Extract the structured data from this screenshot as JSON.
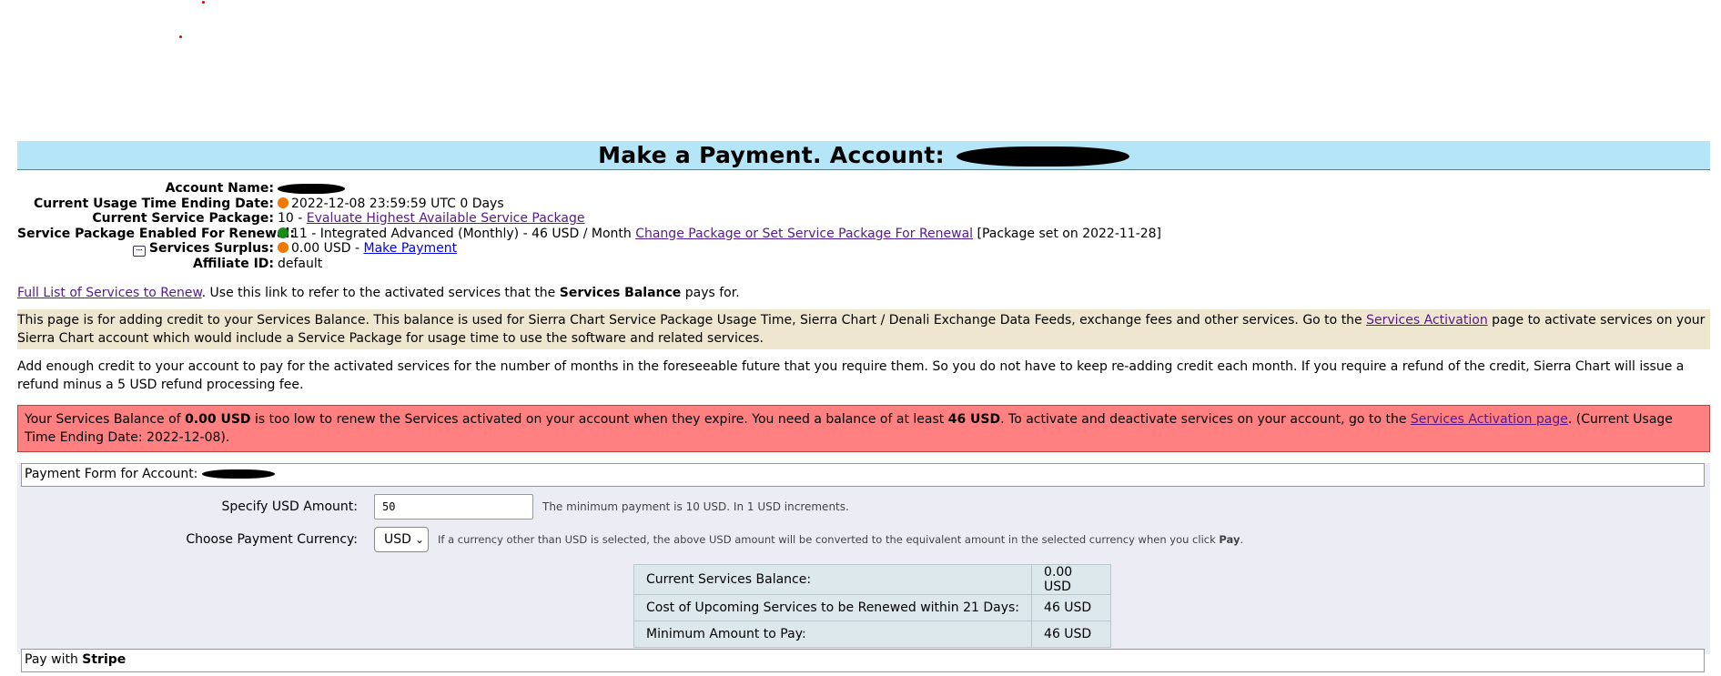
{
  "header": {
    "title": "Make a Payment. Account:"
  },
  "account": {
    "account_name_label": "Account Name:",
    "usage_label": "Current Usage Time Ending Date:",
    "usage_value": "2022-12-08 23:59:59 UTC 0 Days",
    "package_label": "Current Service Package:",
    "package_value": "10 -",
    "package_link": "Evaluate Highest Available Service Package",
    "renewal_label": "Service Package Enabled For Renewal:",
    "renewal_value": "11 - Integrated Advanced (Monthly) - 46 USD / Month",
    "renewal_link": "Change Package or Set Service Package For Renewal",
    "renewal_note": "[Package set on 2022-11-28]",
    "surplus_label": "Services Surplus:",
    "surplus_value": "0.00 USD -",
    "surplus_link": "Make Payment",
    "affiliate_label": "Affiliate ID:",
    "affiliate_value": "default"
  },
  "renew": {
    "link": "Full List of Services to Renew",
    "text1": ". Use this link to refer to the activated services that the ",
    "bold": "Services Balance",
    "text2": " pays for."
  },
  "info_para": {
    "text1": "This page is for adding credit to your Services Balance. This balance is used for Sierra Chart Service Package Usage Time, Sierra Chart / Denali Exchange Data Feeds, exchange fees and other services. Go to the ",
    "link": "Services Activation",
    "text2": " page to activate services on your Sierra Chart account which would include a Service Package for usage time to use the software and related services."
  },
  "add_para": {
    "text": "Add enough credit to your account to pay for the activated services for the number of months in the foreseeable future that you require them. So you do not have to keep re-adding credit each month. If you require a refund of the credit, Sierra Chart will issue a refund minus a 5 USD refund processing fee."
  },
  "alert": {
    "t1": "Your Services Balance of ",
    "b1": "0.00 USD",
    "t2": " is too low to renew the Services activated on your account when they expire. You need a balance of at least ",
    "b2": "46 USD",
    "t3": ". To activate and deactivate services on your account, go to the ",
    "link": "Services Activation page",
    "t4": ". (Current Usage Time Ending Date: 2022-12-08)."
  },
  "form": {
    "legend": "Payment Form for Account:",
    "amount_label": "Specify USD Amount:",
    "amount_value": "50",
    "amount_hint": "The minimum payment is 10 USD. In 1 USD increments.",
    "currency_label": "Choose Payment Currency:",
    "currency_value": "USD",
    "currency_hint": "If a currency other than USD is selected, the above USD amount will be converted to the equivalent amount in the selected currency when you click ",
    "currency_hint_bold": "Pay",
    "currency_hint_end": "."
  },
  "summary": [
    {
      "label": "Current Services Balance:",
      "value": "0.00 USD"
    },
    {
      "label": "Cost of Upcoming Services to be Renewed within 21 Days:",
      "value": "46 USD"
    },
    {
      "label": "Minimum Amount to Pay:",
      "value": "46 USD"
    }
  ],
  "pay": {
    "label": "Pay with ",
    "bold": "Stripe"
  },
  "colors": {
    "title_bar": "#b5e6f7",
    "alert_bg": "#ff8080",
    "info_bg": "#eee6cf",
    "form_bg": "#ececf4",
    "status_orange": "#f07800",
    "status_green": "#1a8a1a"
  }
}
